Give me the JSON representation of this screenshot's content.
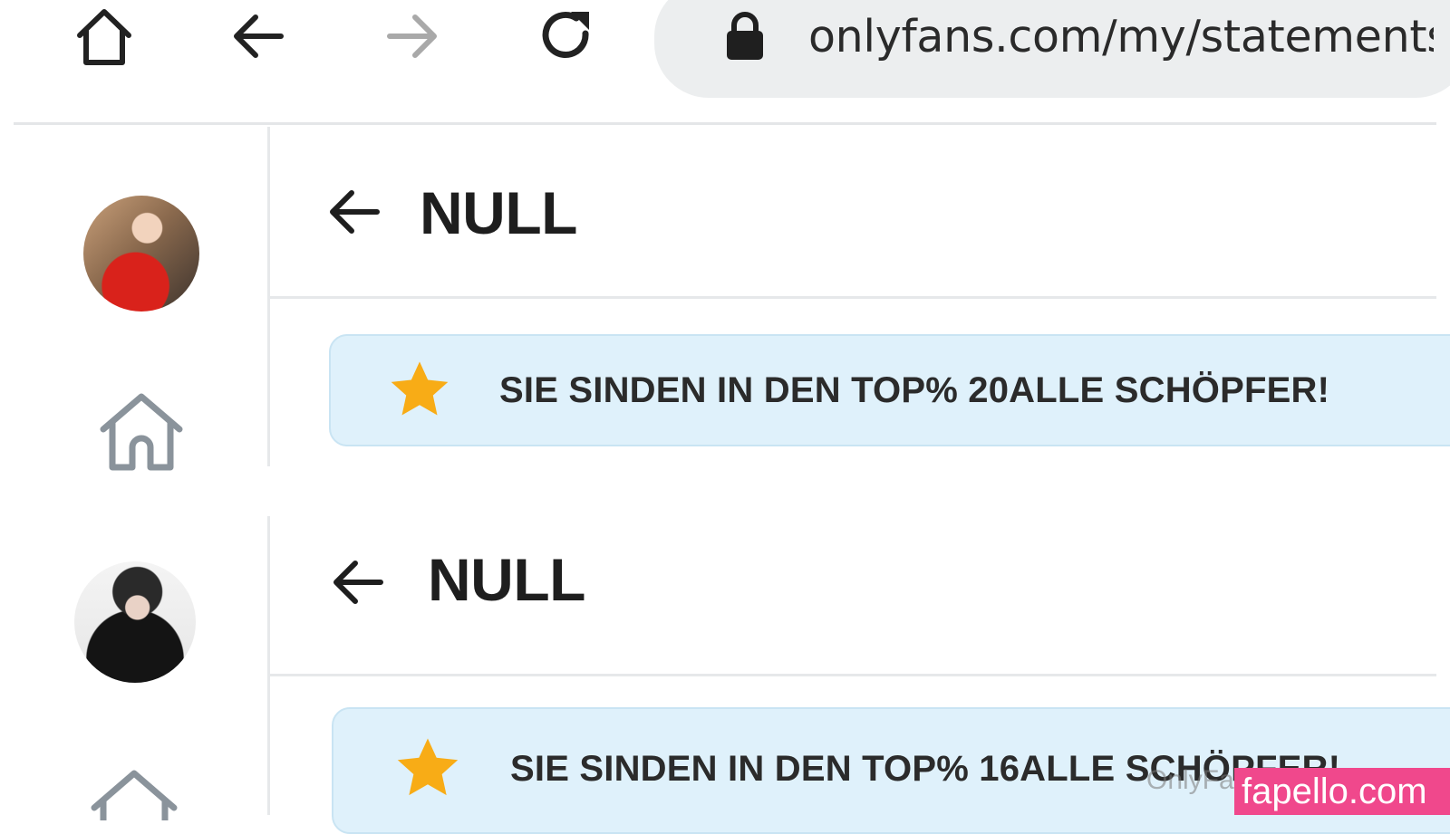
{
  "browser": {
    "url": "onlyfans.com/my/statements"
  },
  "panels": [
    {
      "title": "NULL",
      "banner_text": "SIE SINDEN IN DEN TOP% 20ALLE SCHÖPFER!"
    },
    {
      "title": "NULL",
      "banner_text": "SIE SINDEN IN DEN TOP% 16ALLE SCHÖPFER!"
    }
  ],
  "watermark": "OnlyFans",
  "site_badge": "fapello.com",
  "colors": {
    "banner_bg": "#dff1fb",
    "star": "#f8ac16",
    "badge": "#f0488c"
  },
  "icons": {
    "home": "home-icon",
    "back": "arrow-left-icon",
    "forward": "arrow-right-icon",
    "reload": "reload-icon",
    "lock": "lock-icon",
    "star": "star-icon"
  }
}
